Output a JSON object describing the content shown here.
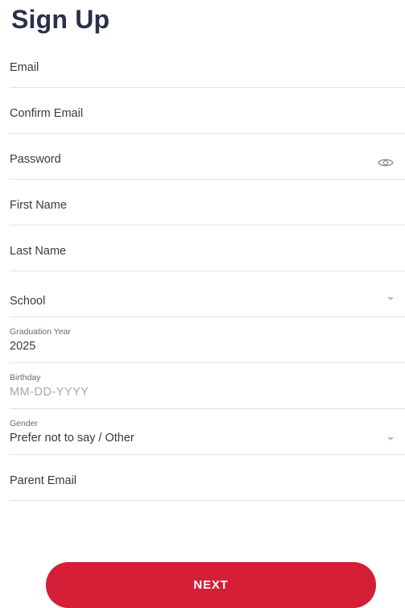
{
  "page": {
    "title": "Sign Up"
  },
  "form": {
    "email_label": "Email",
    "confirm_email_label": "Confirm Email",
    "password_label": "Password",
    "first_name_label": "First Name",
    "last_name_label": "Last Name",
    "school_label": "School",
    "graduation_year_label": "Graduation Year",
    "graduation_year_value": "2025",
    "birthday_label": "Birthday",
    "birthday_placeholder": "MM-DD-YYYY",
    "gender_label": "Gender",
    "gender_value": "Prefer not to say / Other",
    "parent_email_label": "Parent Email"
  },
  "actions": {
    "next_label": "NEXT"
  },
  "icons": {
    "password_toggle": "eye-icon",
    "dropdown": "chevron-down-icon"
  },
  "colors": {
    "title": "#2b2f4a",
    "primary_button": "#d41f37",
    "divider": "#e3e3e3"
  }
}
